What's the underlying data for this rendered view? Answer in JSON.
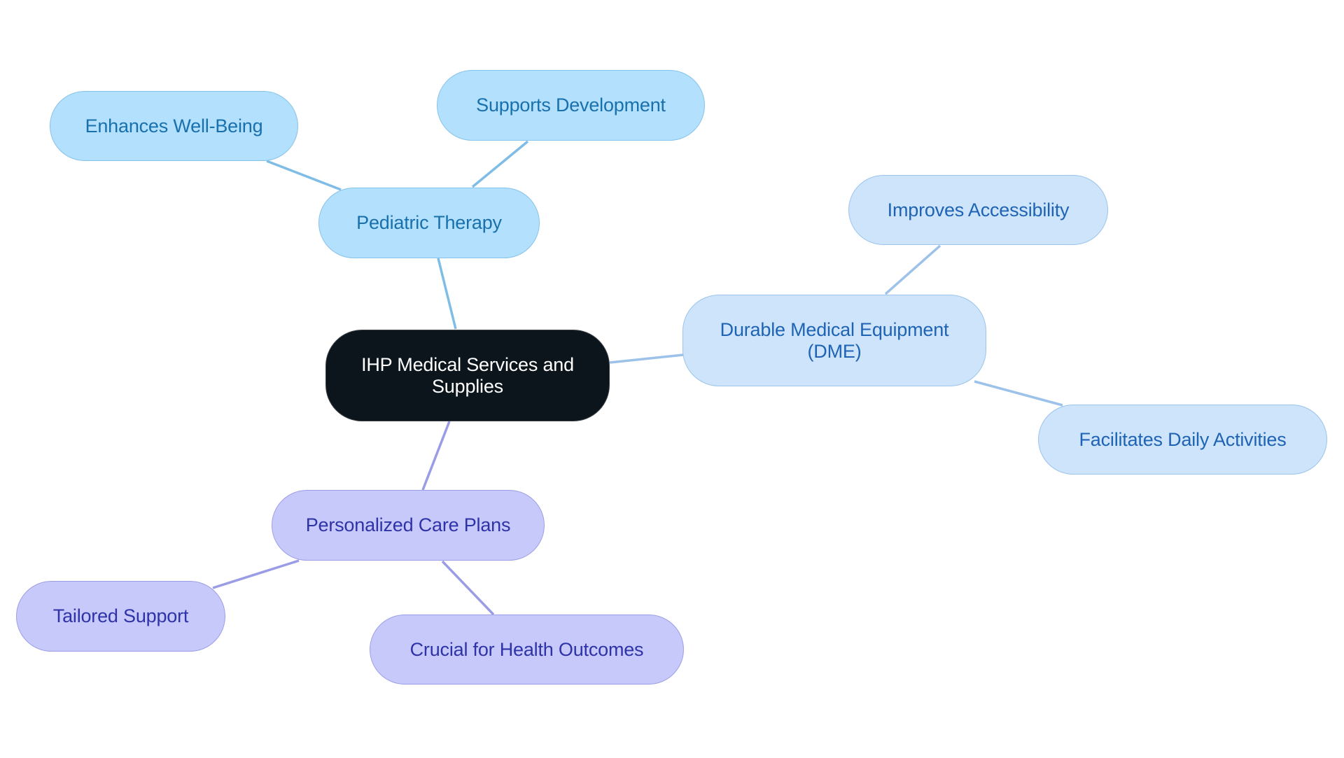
{
  "diagram": {
    "type": "mind-map",
    "root": {
      "id": "root",
      "label": "IHP Medical Services and Supplies",
      "colors": {
        "fill": "#0d151c",
        "stroke": "#3a3f45",
        "text": "#ffffff"
      }
    },
    "branches": [
      {
        "id": "pediatric-therapy",
        "label": "Pediatric Therapy",
        "colors": {
          "fill": "#b3e0fc",
          "stroke": "#86c3ea",
          "text": "#1870ad",
          "edge": "#7fbde6"
        },
        "children": [
          {
            "id": "enhances-well-being",
            "label": "Enhances Well-Being"
          },
          {
            "id": "supports-development",
            "label": "Supports Development"
          }
        ]
      },
      {
        "id": "dme",
        "label": "Durable Medical Equipment (DME)",
        "colors": {
          "fill": "#cde4fb",
          "stroke": "#9cc4ec",
          "text": "#1f63b5",
          "edge": "#9cc2ea"
        },
        "children": [
          {
            "id": "improves-accessibility",
            "label": "Improves Accessibility"
          },
          {
            "id": "facilitates-daily-activities",
            "label": "Facilitates Daily Activities"
          }
        ]
      },
      {
        "id": "personalized-care-plans",
        "label": "Personalized Care Plans",
        "colors": {
          "fill": "#c7c9fb",
          "stroke": "#9d9fe6",
          "text": "#2e33a8",
          "edge": "#9a9de6"
        },
        "children": [
          {
            "id": "tailored-support",
            "label": "Tailored Support"
          },
          {
            "id": "crucial-for-health-outcomes",
            "label": "Crucial for Health Outcomes"
          }
        ]
      }
    ],
    "edges": [
      {
        "from": "root",
        "to": "pediatric-therapy"
      },
      {
        "from": "pediatric-therapy",
        "to": "enhances-well-being"
      },
      {
        "from": "pediatric-therapy",
        "to": "supports-development"
      },
      {
        "from": "root",
        "to": "dme"
      },
      {
        "from": "dme",
        "to": "improves-accessibility"
      },
      {
        "from": "dme",
        "to": "facilitates-daily-activities"
      },
      {
        "from": "root",
        "to": "personalized-care-plans"
      },
      {
        "from": "personalized-care-plans",
        "to": "tailored-support"
      },
      {
        "from": "personalized-care-plans",
        "to": "crucial-for-health-outcomes"
      }
    ]
  }
}
